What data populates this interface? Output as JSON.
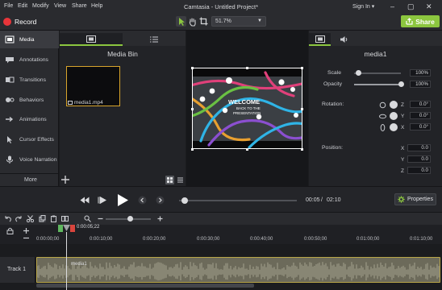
{
  "menubar": {
    "items": [
      "File",
      "Edit",
      "Modify",
      "View",
      "Share",
      "Help"
    ],
    "title": "Camtasia - Untitled Project*",
    "signin": "Sign In",
    "window_buttons": [
      "–",
      "▢",
      "✕"
    ]
  },
  "toolbar": {
    "record_label": "Record",
    "zoom_value": "51.7%",
    "share_label": "Share"
  },
  "sidebar": {
    "items": [
      "Media",
      "Annotations",
      "Transitions",
      "Behaviors",
      "Animations",
      "Cursor Effects",
      "Voice Narration"
    ],
    "more_label": "More"
  },
  "media_bin": {
    "title": "Media Bin",
    "clip_name": "media1.mp4"
  },
  "canvas": {
    "video_text_1": "WELCOME",
    "video_text_2": "BACK TO THE",
    "video_text_3": "PRESENTATION"
  },
  "properties": {
    "title": "media1",
    "scale_label": "Scale",
    "scale_value": "100%",
    "scale_fraction": 1.0,
    "opacity_label": "Opacity",
    "opacity_value": "100%",
    "opacity_fraction": 1.0,
    "rotation_label": "Rotation:",
    "rotation": {
      "z": "0.0°",
      "y": "0.0°",
      "x": "0.0°"
    },
    "position_label": "Position:",
    "position": {
      "x": "0.0",
      "y": "0.0",
      "z": "0.0"
    },
    "axis_labels": [
      "Z",
      "Y",
      "X"
    ],
    "pos_axis_labels": [
      "X",
      "Y",
      "Z"
    ]
  },
  "transport": {
    "time_current": "00:05",
    "time_sep": "/",
    "time_total": "02:10",
    "properties_label": "Properties"
  },
  "timeline": {
    "playhead_time": "0:00:05;22",
    "ruler_labels": [
      "0:00:00;00",
      "0:00:10;00",
      "0:00:20;00",
      "0:00:30;00",
      "0:00:40;00",
      "0:00:50;00",
      "0:01:00;00",
      "0:01:10;00"
    ],
    "track_label": "Track 1",
    "clip_label": "media1"
  },
  "colors": {
    "accent": "#8cc63f",
    "record": "#e8353a",
    "clip_border": "#b9a648"
  }
}
